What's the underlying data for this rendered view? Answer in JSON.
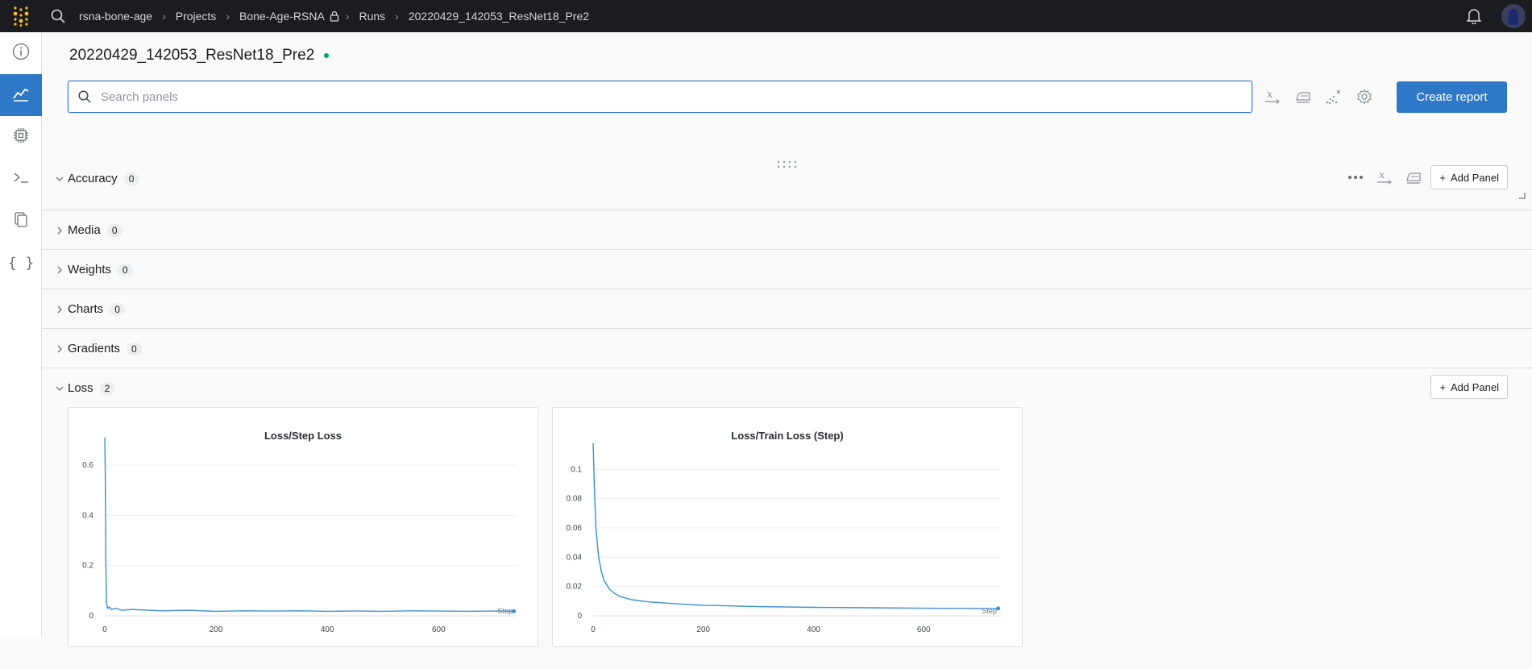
{
  "topbar": {
    "breadcrumbs": [
      "rsna-bone-age",
      "Projects",
      "Bone-Age-RSNA",
      "Runs",
      "20220429_142053_ResNet18_Pre2"
    ]
  },
  "sidebar": {
    "items": [
      {
        "icon": "info-icon",
        "label": "Overview"
      },
      {
        "icon": "chart-icon",
        "label": "Charts",
        "active": true
      },
      {
        "icon": "cpu-icon",
        "label": "System"
      },
      {
        "icon": "terminal-icon",
        "label": "Logs"
      },
      {
        "icon": "files-icon",
        "label": "Files"
      },
      {
        "icon": "code-icon",
        "label": "Artifacts"
      }
    ]
  },
  "run": {
    "name": "20220429_142053_ResNet18_Pre2",
    "status_color": "#00a86b"
  },
  "search": {
    "placeholder": "Search panels",
    "value": ""
  },
  "toolbar": {
    "create_report_label": "Create report"
  },
  "sections": [
    {
      "name": "Accuracy",
      "count": "0",
      "expanded": true
    },
    {
      "name": "Media",
      "count": "0",
      "expanded": false
    },
    {
      "name": "Weights",
      "count": "0",
      "expanded": false
    },
    {
      "name": "Charts",
      "count": "0",
      "expanded": false
    },
    {
      "name": "Gradients",
      "count": "0",
      "expanded": false
    },
    {
      "name": "Loss",
      "count": "2",
      "expanded": true
    }
  ],
  "add_panel_label": "Add Panel",
  "colors": {
    "accent": "#2e78c7",
    "series": "#3b8fd6",
    "topbar": "#1a1c1f"
  },
  "chart_data": [
    {
      "type": "line",
      "title": "Loss/Step Loss",
      "xlabel": "Step",
      "ylabel": "",
      "xlim": [
        0,
        740
      ],
      "ylim": [
        0,
        0.7
      ],
      "yticks": [
        0,
        0.2,
        0.4,
        0.6
      ],
      "xticks": [
        0,
        200,
        400,
        600
      ],
      "grid": true,
      "series": [
        {
          "x": [
            0,
            1,
            2,
            3,
            5,
            8,
            12,
            20,
            30,
            50,
            80,
            100,
            150,
            200,
            250,
            300,
            350,
            400,
            450,
            500,
            550,
            600,
            650,
            700,
            735
          ],
          "y": [
            0.71,
            0.55,
            0.2,
            0.05,
            0.03,
            0.035,
            0.025,
            0.03,
            0.022,
            0.025,
            0.022,
            0.02,
            0.022,
            0.018,
            0.02,
            0.019,
            0.02,
            0.018,
            0.019,
            0.018,
            0.02,
            0.019,
            0.018,
            0.019,
            0.018
          ]
        }
      ]
    },
    {
      "type": "line",
      "title": "Loss/Train Loss (Step)",
      "xlabel": "Step",
      "ylabel": "",
      "xlim": [
        0,
        740
      ],
      "ylim": [
        0,
        0.12
      ],
      "yticks": [
        0,
        0.02,
        0.04,
        0.06,
        0.08,
        0.1
      ],
      "xticks": [
        0,
        200,
        400,
        600
      ],
      "grid": true,
      "series": [
        {
          "x": [
            0,
            2,
            5,
            10,
            15,
            20,
            30,
            40,
            50,
            70,
            100,
            150,
            200,
            300,
            400,
            500,
            600,
            700,
            735
          ],
          "y": [
            0.118,
            0.09,
            0.06,
            0.04,
            0.03,
            0.024,
            0.018,
            0.015,
            0.013,
            0.011,
            0.0095,
            0.0082,
            0.0072,
            0.0063,
            0.0058,
            0.0055,
            0.0052,
            0.005,
            0.005
          ]
        }
      ]
    }
  ]
}
